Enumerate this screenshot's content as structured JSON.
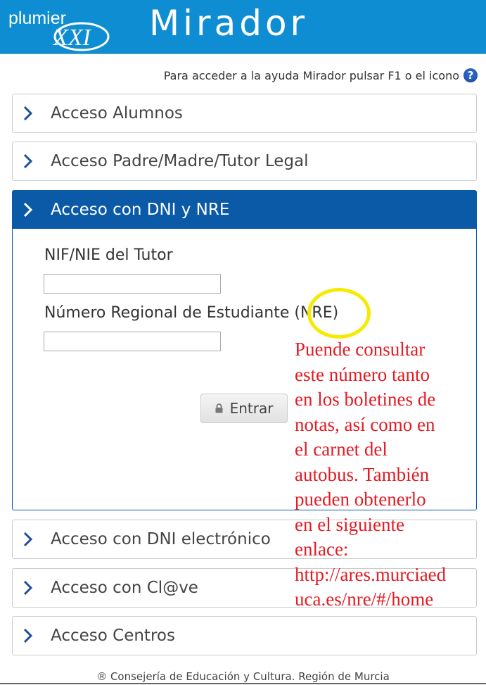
{
  "header": {
    "logo_text_top": "plumier",
    "logo_text_bottom": "XXI",
    "app_title": "Mirador",
    "bg_color": "#0e8dd2"
  },
  "help": {
    "text": "Para acceder a la ayuda Mirador pulsar F1 o el icono",
    "icon": "help-icon"
  },
  "panels": [
    {
      "label": "Acceso Alumnos",
      "icon": "chevron-right-icon"
    },
    {
      "label": "Acceso Padre/Madre/Tutor Legal",
      "icon": "chevron-right-icon"
    },
    {
      "label": "Acceso con DNI y NRE",
      "icon": "chevron-right-icon",
      "active": true,
      "color": "#0a5aa8"
    },
    {
      "label": "Acceso con DNI electrónico",
      "icon": "chevron-right-icon"
    },
    {
      "label": "Acceso con Cl@ve",
      "icon": "chevron-right-icon"
    },
    {
      "label": "Acceso Centros",
      "icon": "chevron-right-icon"
    }
  ],
  "form": {
    "nif_label": "NIF/NIE del Tutor",
    "nif_value": "",
    "nre_label": "Número Regional de Estudiante (NRE)",
    "nre_value": "",
    "enter_label": "Entrar",
    "enter_icon": "lock-icon"
  },
  "annotation": {
    "color": "#e41b23",
    "highlight_color": "#f5ea00",
    "lines": [
      "Puende consultar",
      "este número tanto",
      "en los boletines de",
      "notas, así como en",
      "el carnet del",
      "autobus. También",
      "pueden obtenerlo",
      "en el siguiente",
      "enlace:",
      "http://ares.murciaed",
      "uca.es/nre/#/home"
    ]
  },
  "footer": {
    "text": "® Consejería de Educación y Cultura. Región de Murcia"
  }
}
